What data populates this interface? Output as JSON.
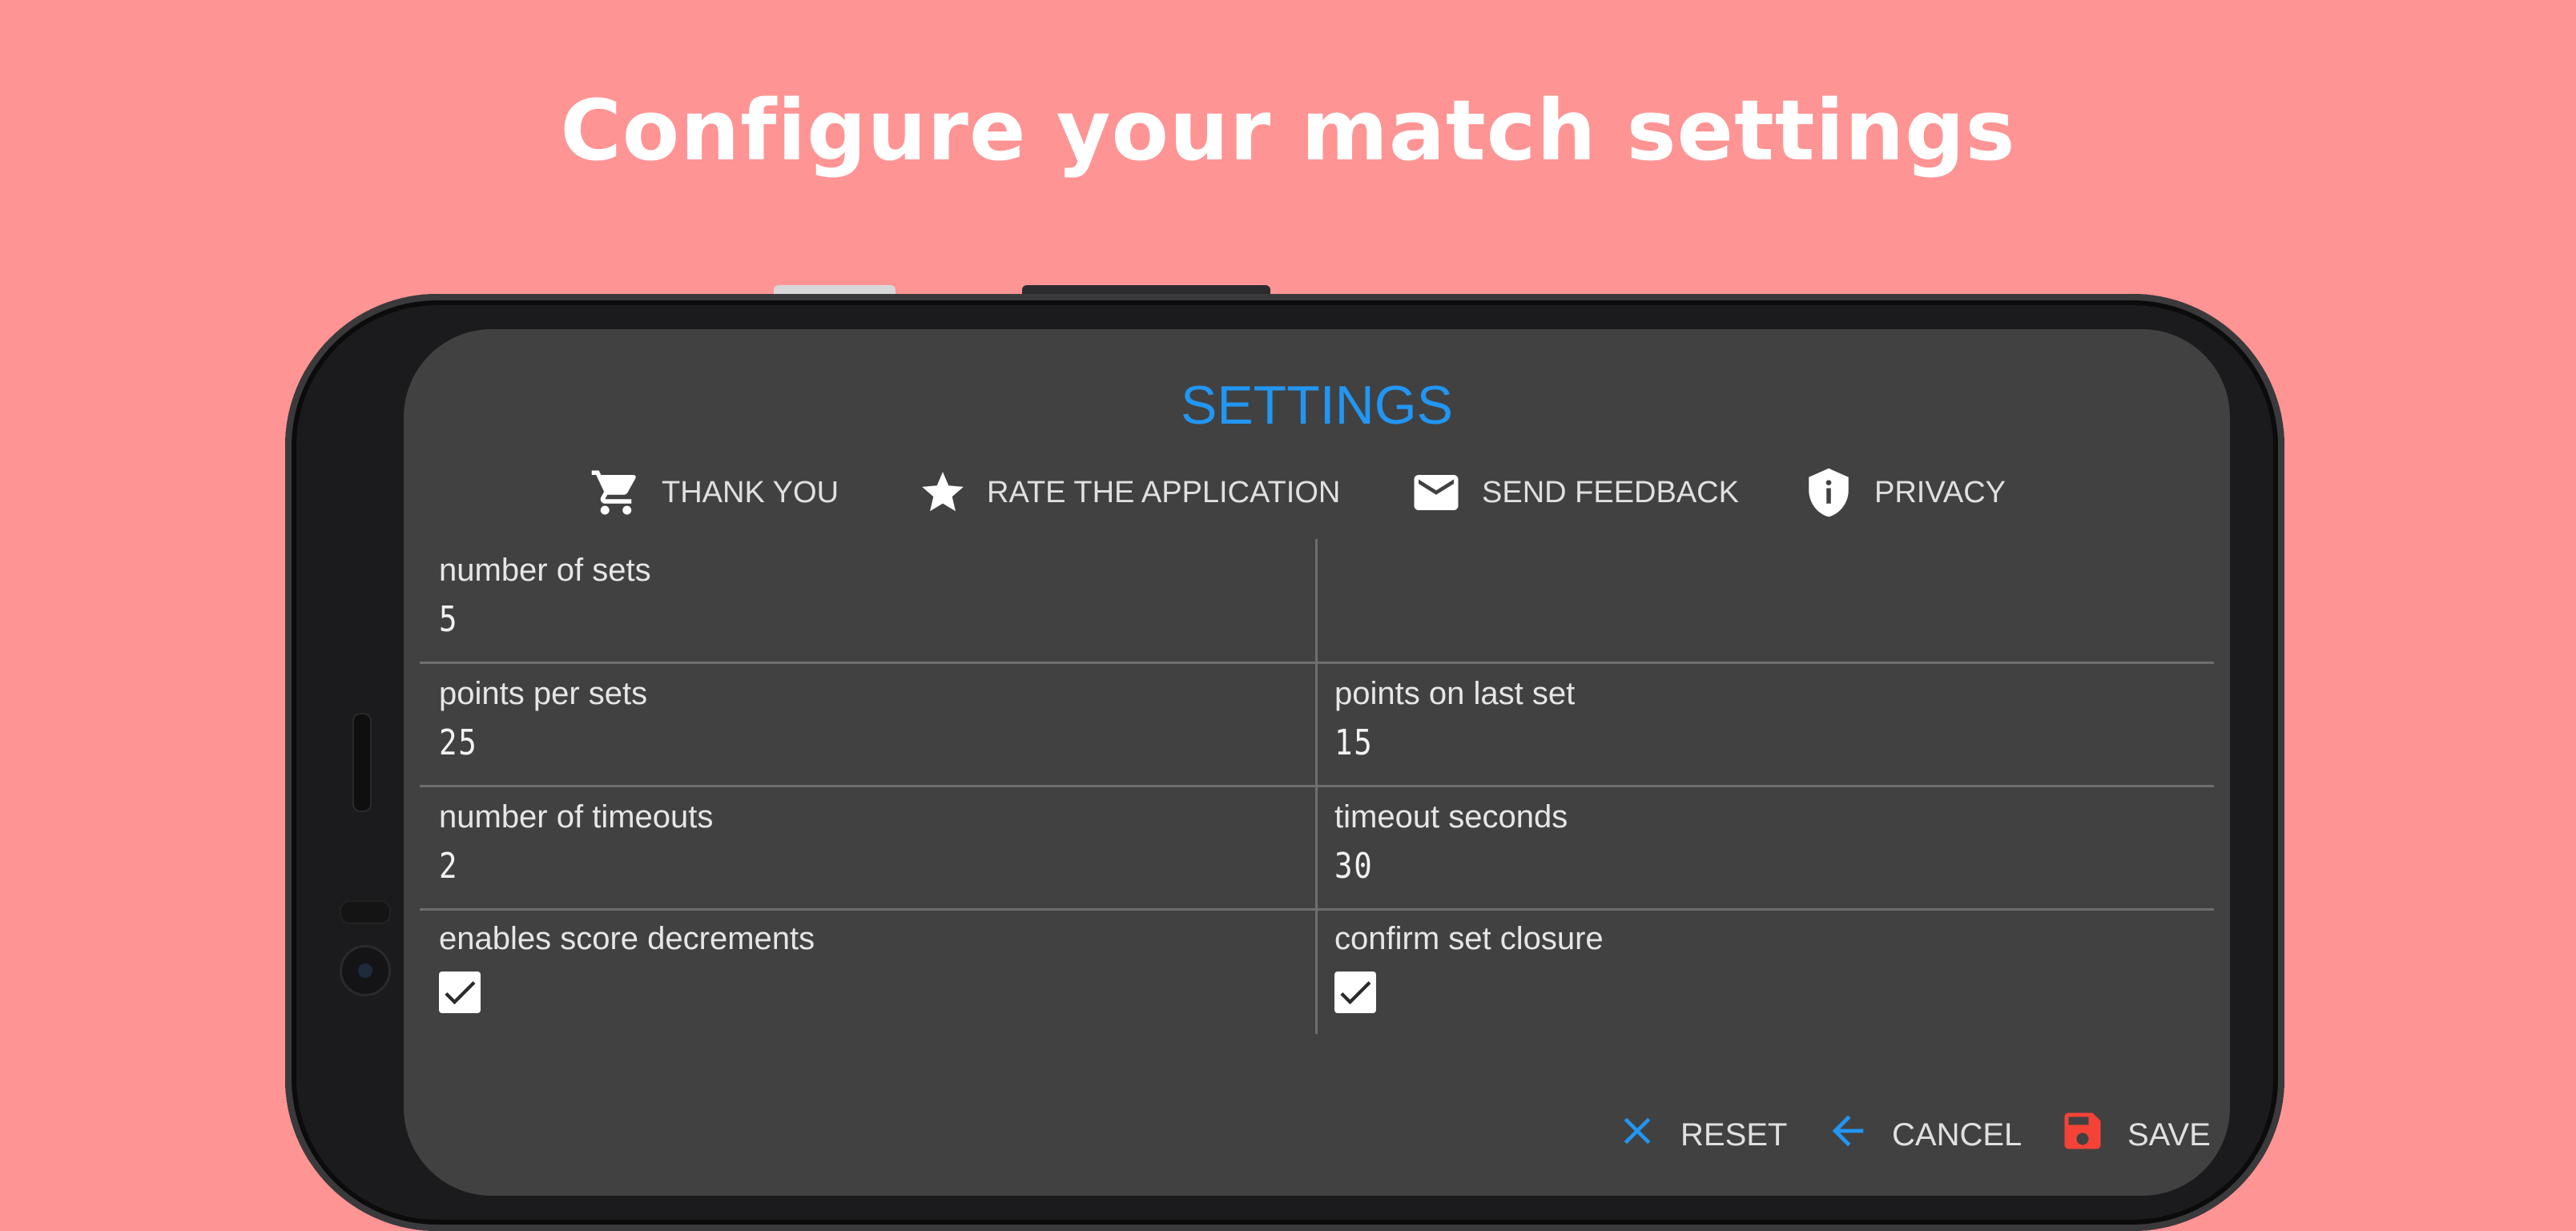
{
  "headline": "Configure your match settings",
  "settings": {
    "title": "SETTINGS",
    "menu": [
      {
        "label": "THANK YOU",
        "icon": "cart-icon"
      },
      {
        "label": "RATE THE APPLICATION",
        "icon": "star-icon"
      },
      {
        "label": "SEND FEEDBACK",
        "icon": "mail-icon"
      },
      {
        "label": "PRIVACY",
        "icon": "shield-info-icon"
      }
    ],
    "fields": {
      "number_of_sets": {
        "label": "number of sets",
        "value": "5"
      },
      "points_per_sets": {
        "label": "points per sets",
        "value": "25"
      },
      "points_on_last_set": {
        "label": "points on last set",
        "value": "15"
      },
      "number_of_timeouts": {
        "label": "number of timeouts",
        "value": "2"
      },
      "timeout_seconds": {
        "label": "timeout seconds",
        "value": "30"
      },
      "enables_score_decrements": {
        "label": "enables score decrements",
        "checked": true
      },
      "confirm_set_closure": {
        "label": "confirm set closure",
        "checked": true
      }
    },
    "actions": [
      {
        "label": "RESET",
        "icon": "close-icon"
      },
      {
        "label": "CANCEL",
        "icon": "arrow-left-icon"
      },
      {
        "label": "SAVE",
        "icon": "save-icon"
      }
    ]
  },
  "colors": {
    "background": "#ff9494",
    "screen": "#414141",
    "accent": "#2196f3",
    "save": "#f44336"
  }
}
